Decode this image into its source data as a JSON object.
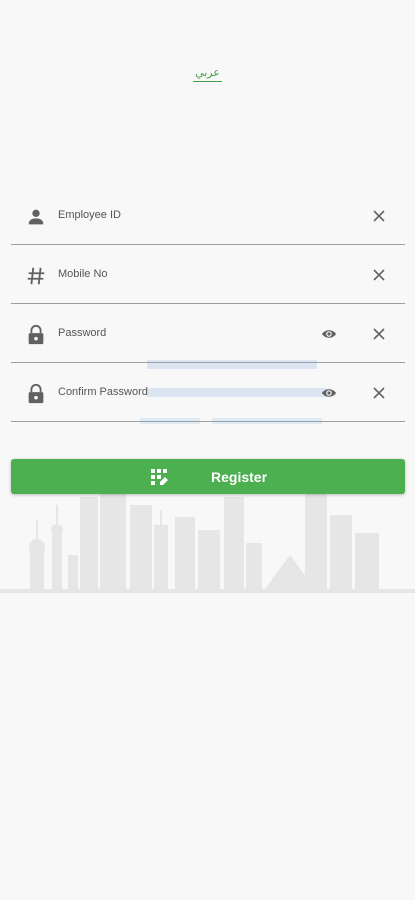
{
  "language_toggle": "عربي",
  "fields": {
    "employee_id": "Employee ID",
    "mobile_no": "Mobile No",
    "password": "Password",
    "confirm_password": "Confirm Password"
  },
  "register_label": "Register",
  "colors": {
    "accent": "#4caf50",
    "background": "#f8f8f8",
    "icon": "#616161"
  },
  "icons": {
    "logo": "crescent-logo-icon",
    "employee_id": "person-icon",
    "mobile_no": "hash-icon",
    "password": "lock-icon",
    "visibility": "eye-icon",
    "clear": "close-icon",
    "register": "grid-pencil-icon"
  }
}
